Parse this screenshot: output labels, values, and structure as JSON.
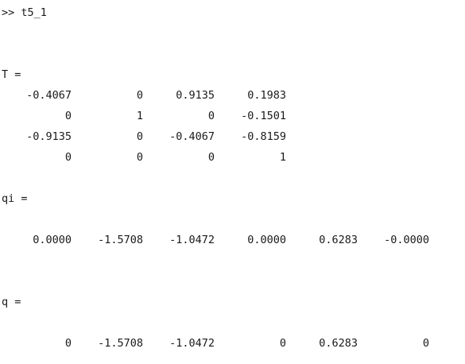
{
  "command_line": ">> t5_1",
  "T": {
    "label": "T =",
    "rows": [
      [
        "-0.4067",
        "0",
        "0.9135",
        "0.1983"
      ],
      [
        "0",
        "1",
        "0",
        "-0.1501"
      ],
      [
        "-0.9135",
        "0",
        "-0.4067",
        "-0.8159"
      ],
      [
        "0",
        "0",
        "0",
        "1"
      ]
    ]
  },
  "qi": {
    "label": "qi =",
    "values": [
      "0.0000",
      "-1.5708",
      "-1.0472",
      "0.0000",
      "0.6283",
      "-0.0000"
    ]
  },
  "q": {
    "label": "q =",
    "values": [
      "0",
      "-1.5708",
      "-1.0472",
      "0",
      "0.6283",
      "0"
    ]
  }
}
